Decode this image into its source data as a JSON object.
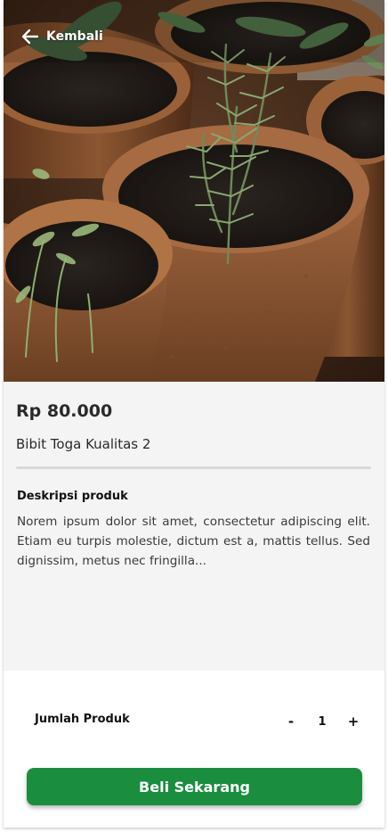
{
  "header": {
    "back_label": "Kembali",
    "back_icon": "arrow-left-icon"
  },
  "product": {
    "price": "Rp 80.000",
    "name": "Bibit Toga Kualitas 2",
    "description_title": "Deskripsi produk",
    "description": "Norem ipsum dolor sit amet, consectetur adipiscing elit. Etiam eu turpis molestie, dictum est a, mattis tellus. Sed dignissim, metus nec fringilla..."
  },
  "quantity": {
    "label": "Jumlah Produk",
    "decrement": "-",
    "value": "1",
    "increment": "+"
  },
  "actions": {
    "buy_label": "Beli Sekarang"
  },
  "colors": {
    "accent": "#1a8d3f",
    "background": "#f4f4f4"
  }
}
